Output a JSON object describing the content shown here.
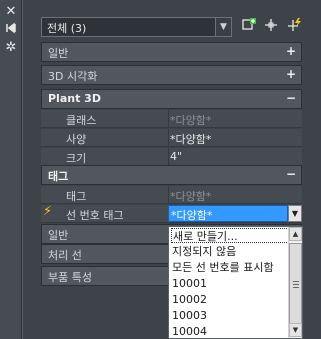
{
  "left_strip": {
    "icons": [
      "close-icon",
      "dock-icon",
      "settings-icon"
    ]
  },
  "selector": {
    "value": "전체 (3)"
  },
  "toolbar": {
    "icons": [
      "add-to-selection-icon",
      "select-objects-icon",
      "quick-select-icon"
    ]
  },
  "sections": {
    "general": {
      "label": "일반",
      "sign": "+"
    },
    "visualization_3d": {
      "label": "3D 시각화",
      "sign": "+"
    },
    "plant3d": {
      "label": "Plant 3D",
      "sign": "−"
    },
    "tag": {
      "label": "태그",
      "sign": "−"
    },
    "general2": {
      "label": "일반"
    },
    "line_processing": {
      "label": "처리 선"
    },
    "part_properties": {
      "label": "부품 특성"
    }
  },
  "plant3d_rows": [
    {
      "name": "클래스",
      "value": "*다양함*",
      "dim": true
    },
    {
      "name": "사양",
      "value": "*다양함*",
      "dim": false
    },
    {
      "name": "크기",
      "value": "4\"",
      "dim": false
    }
  ],
  "tag_rows": [
    {
      "name": "태그",
      "value": "*다양함*",
      "dim": true
    }
  ],
  "active_row": {
    "name": "선 번호 태그",
    "value": "*다양함*"
  },
  "dropdown": {
    "options": [
      "새로 만들기...",
      "지정되지 않음",
      "모든 선 번호를 표시함",
      "10001",
      "10002",
      "10003",
      "10004"
    ]
  }
}
